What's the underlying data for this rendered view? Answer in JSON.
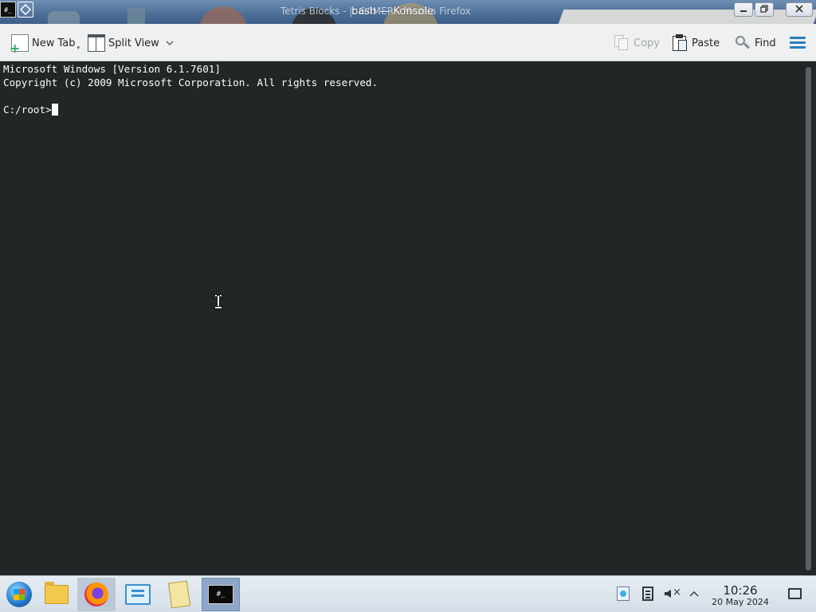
{
  "window": {
    "title": "bash — Konsole",
    "title_background": "Tetris Blocks - |: GAMER - Mozilla Firefox",
    "app_icon_text": "#_"
  },
  "toolbar": {
    "new_tab_label": "New Tab",
    "split_view_label": "Split View",
    "copy_label": "Copy",
    "paste_label": "Paste",
    "find_label": "Find"
  },
  "terminal": {
    "line1": "Microsoft Windows [Version 6.1.7601]",
    "line2": "Copyright (c) 2009 Microsoft Corporation. All rights reserved.",
    "prompt": "C:/root>"
  },
  "taskbar": {
    "konsole_icon_text": "#_",
    "clock_time": "10:26",
    "clock_date": "20 May 2024"
  },
  "colors": {
    "terminal_bg": "#232627",
    "terminal_fg": "#fcfcfc",
    "toolbar_bg": "#eff0f1",
    "accent": "#2980b9"
  },
  "icons": {
    "titlebar": [
      "konsole-icon",
      "keep-above-icon",
      "minimize-icon",
      "maximize-icon",
      "close-icon"
    ],
    "toolbar": [
      "new-tab-icon",
      "split-view-icon",
      "chevron-down-icon",
      "copy-icon",
      "paste-icon",
      "find-icon",
      "hamburger-menu-icon"
    ],
    "taskbar": [
      "start-menu-icon",
      "file-manager-icon",
      "firefox-icon",
      "network-monitor-icon",
      "notes-icon",
      "konsole-icon"
    ],
    "tray": [
      "updates-icon",
      "clipboard-icon",
      "volume-muted-icon",
      "expand-tray-icon",
      "show-desktop-icon"
    ]
  }
}
